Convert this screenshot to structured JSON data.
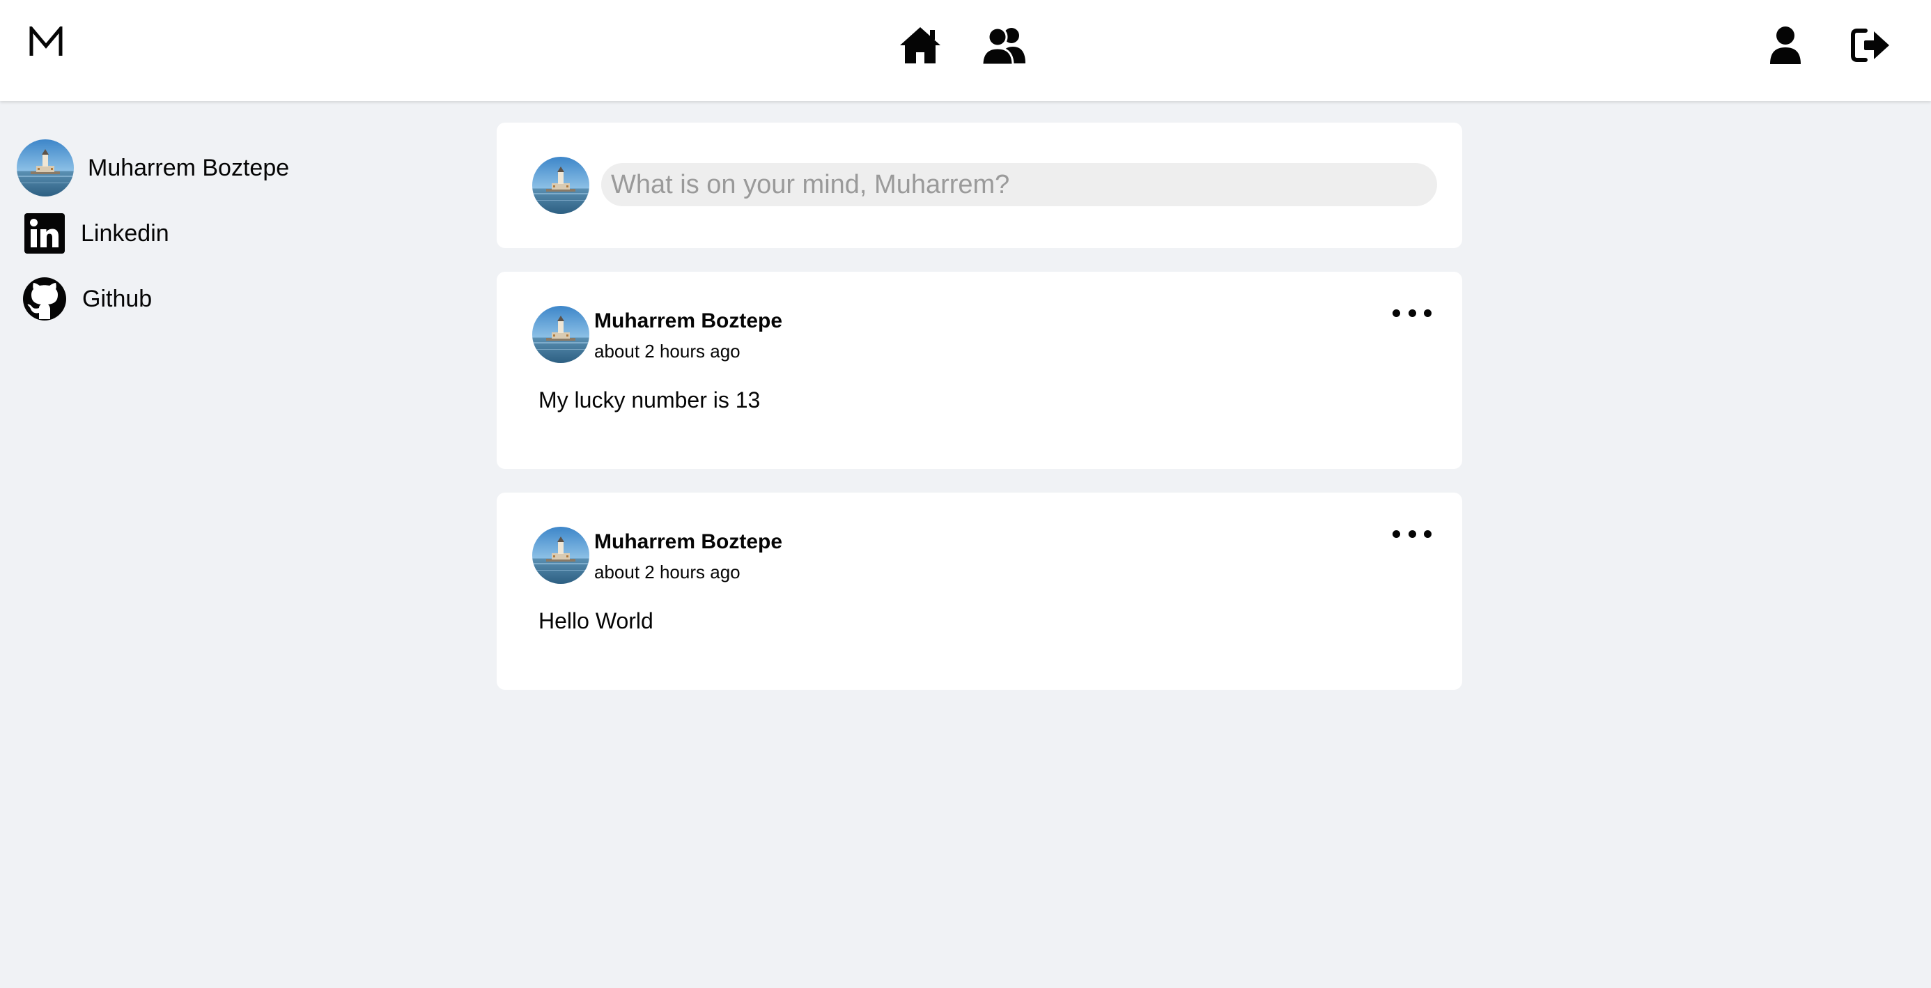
{
  "brand": {
    "logo_text": "M"
  },
  "nav": {
    "center": [
      {
        "icon": "home-icon"
      },
      {
        "icon": "users-icon"
      }
    ],
    "right": [
      {
        "icon": "user-icon"
      },
      {
        "icon": "logout-icon"
      }
    ]
  },
  "sidebar": {
    "profile_name": "Muharrem Boztepe",
    "links": [
      {
        "label": "Linkedin",
        "icon": "linkedin-icon"
      },
      {
        "label": "Github",
        "icon": "github-icon"
      }
    ]
  },
  "composer": {
    "placeholder": "What is on your mind, Muharrem?",
    "value": ""
  },
  "posts": [
    {
      "author": "Muharrem Boztepe",
      "time": "about 2 hours ago",
      "text": "My lucky number is 13"
    },
    {
      "author": "Muharrem Boztepe",
      "time": "about 2 hours ago",
      "text": "Hello World"
    }
  ],
  "colors": {
    "background": "#f0f2f5",
    "card": "#ffffff",
    "text": "#050505",
    "input_bg": "#eeeeee",
    "placeholder": "#9a9a9a"
  }
}
